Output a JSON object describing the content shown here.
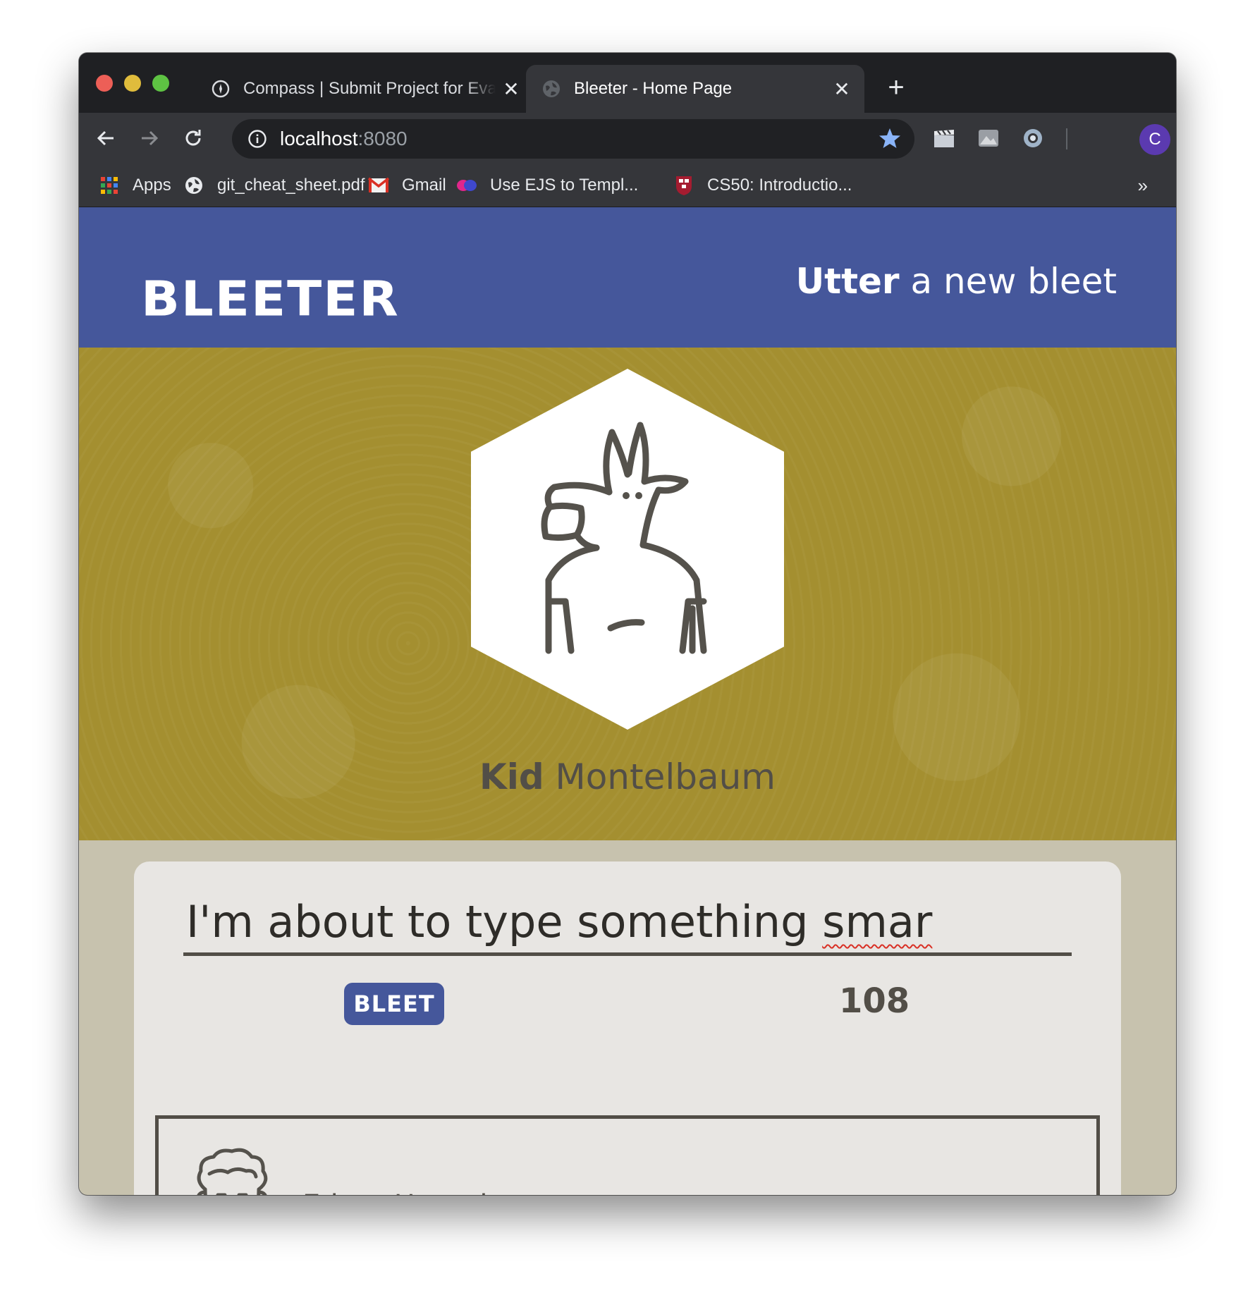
{
  "browser": {
    "tabs": [
      {
        "title": "Compass | Submit Project for Evaluation",
        "close": "✕",
        "active": false
      },
      {
        "title": "Bleeter - Home Page",
        "close": "✕",
        "active": true
      }
    ],
    "new_tab": "+",
    "address": {
      "host": "localhost",
      "port": ":8080"
    },
    "bookmarks": [
      {
        "label": "Apps",
        "icon": "apps-grid-icon"
      },
      {
        "label": "git_cheat_sheet.pdf",
        "icon": "globe-icon"
      },
      {
        "label": "Gmail",
        "icon": "gmail-icon"
      },
      {
        "label": "Use EJS to Templ...",
        "icon": "ejs-icon"
      },
      {
        "label": "CS50: Introductio...",
        "icon": "harvard-shield-icon"
      }
    ],
    "bookmarks_overflow": "»",
    "profile_initial": "C"
  },
  "site": {
    "logo": "BLEETER",
    "compose_link": {
      "strong": "Utter",
      "rest": " a new bleet"
    },
    "profile": {
      "first_name": "Kid",
      "last_name": " Montelbaum",
      "avatar": "goat-avatar-icon"
    },
    "composer": {
      "text": "I'm about to type something ",
      "misspelled": "smar",
      "button": "BLEET",
      "counter": "108"
    },
    "feed": [
      {
        "author": "Edgar Hussain",
        "avatar": "curly-hair-avatar-icon"
      }
    ]
  },
  "colors": {
    "header": "#45579b",
    "banner": "#a48f30",
    "page_bg": "#c7c2ae",
    "card_bg": "#e8e6e3",
    "ink": "#524e47"
  }
}
